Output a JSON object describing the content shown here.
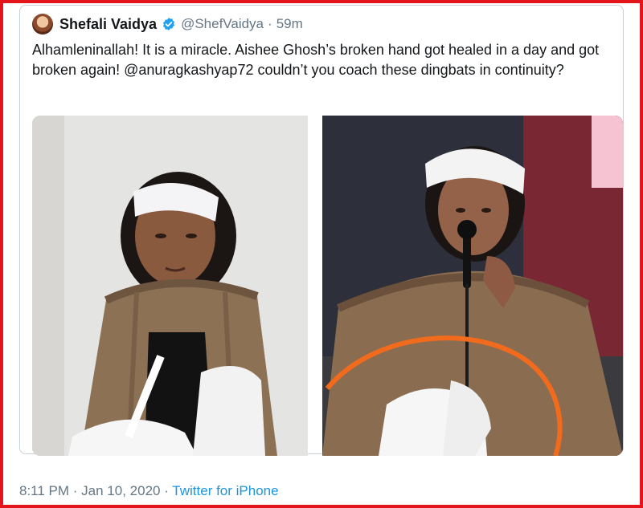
{
  "tweet": {
    "author_name": "Shefali Vaidya",
    "handle": "@ShefVaidya",
    "separator": "·",
    "age": "59m",
    "text": "Alhamleninallah! It is a miracle. Aishee Ghosh’s broken hand got healed in a day and got broken again! @anuragkashyap72 couldn’t you coach these dingbats in continuity?"
  },
  "footer": {
    "time": "8:11 PM",
    "sep1": " · ",
    "date": "Jan 10, 2020",
    "sep2": " · ",
    "source": "Twitter for iPhone"
  },
  "colors": {
    "frame": "#e3151a",
    "verified": "#1da1f2",
    "link": "#1b95e0",
    "highlight_curve": "#f26b1d"
  },
  "icons": {
    "verified": "verified-badge-icon"
  }
}
